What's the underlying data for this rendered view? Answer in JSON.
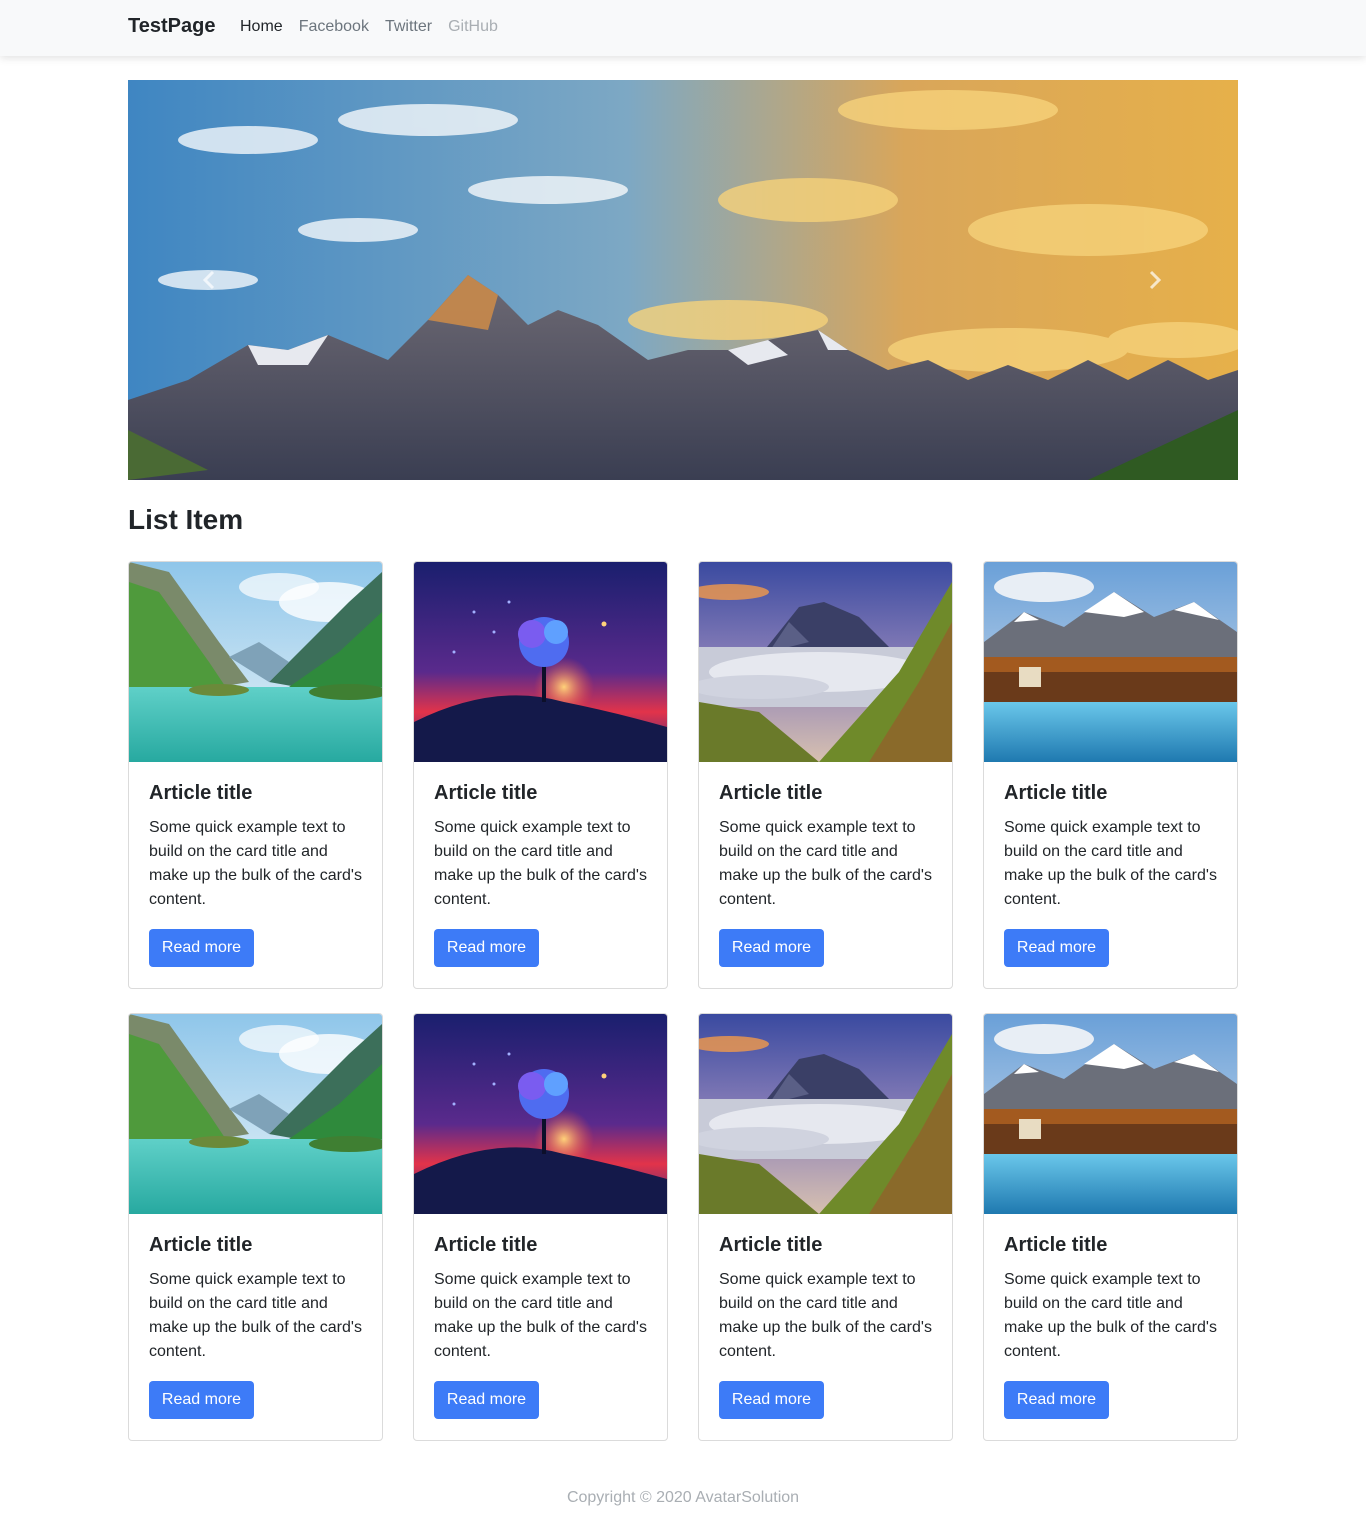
{
  "navbar": {
    "brand": "TestPage",
    "links": [
      {
        "label": "Home",
        "state": "active"
      },
      {
        "label": "Facebook",
        "state": "normal"
      },
      {
        "label": "Twitter",
        "state": "normal"
      },
      {
        "label": "GitHub",
        "state": "disabled"
      }
    ]
  },
  "carousel": {
    "prev_icon": "chevron-left-icon",
    "next_icon": "chevron-right-icon"
  },
  "section": {
    "title": "List Item"
  },
  "cards": [
    {
      "image": "valley-river",
      "title": "Article title",
      "text": "Some quick example text to build on the card title and make up the bulk of the card's content.",
      "button": "Read more"
    },
    {
      "image": "night-tree",
      "title": "Article title",
      "text": "Some quick example text to build on the card title and make up the bulk of the card's content.",
      "button": "Read more"
    },
    {
      "image": "misty-volcano",
      "title": "Article title",
      "text": "Some quick example text to build on the card title and make up the bulk of the card's content.",
      "button": "Read more"
    },
    {
      "image": "alpine-lake",
      "title": "Article title",
      "text": "Some quick example text to build on the card title and make up the bulk of the card's content.",
      "button": "Read more"
    },
    {
      "image": "valley-river",
      "title": "Article title",
      "text": "Some quick example text to build on the card title and make up the bulk of the card's content.",
      "button": "Read more"
    },
    {
      "image": "night-tree",
      "title": "Article title",
      "text": "Some quick example text to build on the card title and make up the bulk of the card's content.",
      "button": "Read more"
    },
    {
      "image": "misty-volcano",
      "title": "Article title",
      "text": "Some quick example text to build on the card title and make up the bulk of the card's content.",
      "button": "Read more"
    },
    {
      "image": "alpine-lake",
      "title": "Article title",
      "text": "Some quick example text to build on the card title and make up the bulk of the card's content.",
      "button": "Read more"
    }
  ],
  "colors": {
    "navbar_bg": "#f8f9fa",
    "button": "#3d7bf7",
    "text": "#212529",
    "muted": "#a9aeb3"
  },
  "footer": {
    "copyright": "Copyright © 2020 AvatarSolution"
  }
}
